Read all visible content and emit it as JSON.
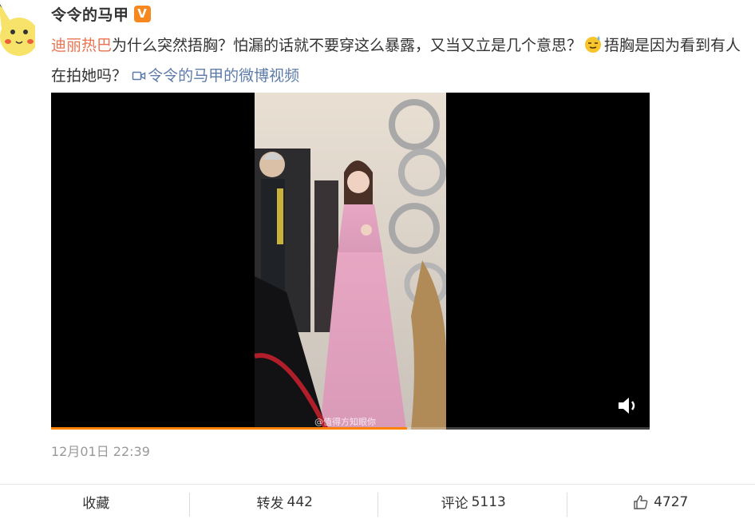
{
  "author": {
    "name": "令令的马甲",
    "verified_badge": "V",
    "avatar_icon": "pikachu-avatar"
  },
  "post": {
    "mention": "迪丽热巴",
    "text_1": "为什么突然捂胸？怕漏的话就不要穿这么暴露，又当又立是几个意思？",
    "emoji": "doge-sweat-emoji",
    "text_2": "捂胸是因为看到有人在拍她吗？",
    "video_link": "令令的马甲的微博视频"
  },
  "video": {
    "watermark": "@值得方知眼你",
    "progress": 0.595,
    "accent_color": "#ff8200"
  },
  "timestamp": "12月01日 22:39",
  "actions": {
    "favorite": "收藏",
    "repost_label": "转发",
    "repost_count": "442",
    "comment_label": "评论",
    "comment_count": "5113",
    "like_count": "4727"
  },
  "colors": {
    "mention": "#eb7350",
    "link": "#5d7ba8",
    "verified": "#f6881f"
  }
}
